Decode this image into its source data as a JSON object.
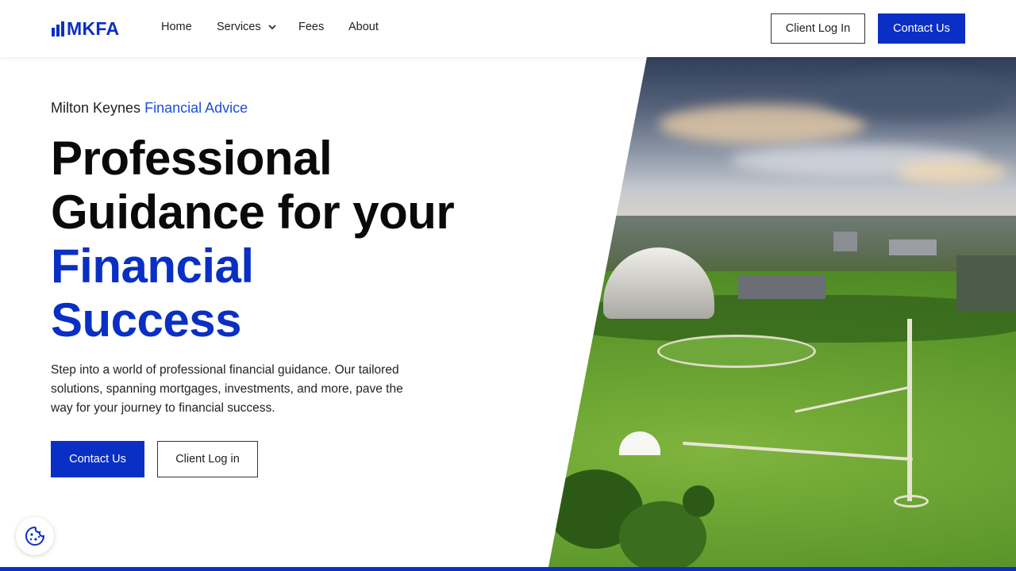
{
  "brand": {
    "name": "MKFA",
    "color": "#0a2fc4",
    "accent": "#1d4fd8"
  },
  "nav": {
    "items": [
      {
        "label": "Home"
      },
      {
        "label": "Services",
        "has_dropdown": true
      },
      {
        "label": "Fees"
      },
      {
        "label": "About"
      }
    ],
    "client_login": "Client Log In",
    "contact": "Contact Us"
  },
  "hero": {
    "eyebrow_plain": "Milton Keynes",
    "eyebrow_accent": "Financial Advice",
    "headline_line1": "Professional",
    "headline_line2": "Guidance for your",
    "headline_line3": "Financial",
    "headline_line4": "Success",
    "lede": "Step into a world of professional financial guidance. Our tailored solutions, spanning mortgages, investments, and more, pave the way for your journey to financial success.",
    "primary_cta": "Contact Us",
    "secondary_cta": "Client Log in",
    "image_icon": "aerial-landscape-photo"
  },
  "cookie": {
    "icon": "cookie-icon"
  }
}
